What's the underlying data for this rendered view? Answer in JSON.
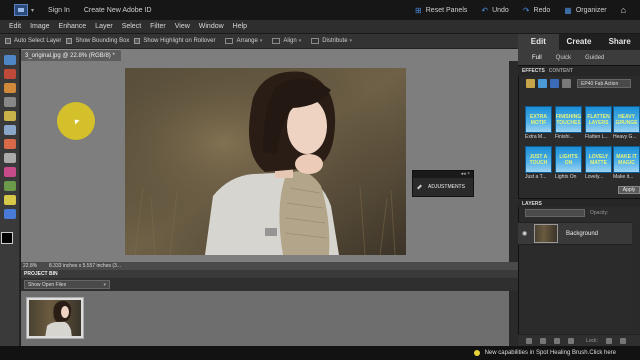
{
  "topbar": {
    "sign_in": "Sign In",
    "create_id": "Create New Adobe ID",
    "reset_panels": "Reset Panels",
    "undo": "Undo",
    "redo": "Redo",
    "organizer": "Organizer"
  },
  "menu": [
    "Edit",
    "Image",
    "Enhance",
    "Layer",
    "Select",
    "Filter",
    "View",
    "Window",
    "Help"
  ],
  "options": {
    "auto_select": "Auto Select Layer",
    "show_bounding": "Show Bounding Box",
    "show_highlight": "Show Highlight on Rollover",
    "arrange": "Arrange",
    "align": "Align",
    "distribute": "Distribute"
  },
  "document": {
    "tab_label": "3_original.jpg @ 22.8% (RGB/8) *",
    "zoom": "22.8%",
    "dimensions": "8.333 inches x 5.557 inches (3..."
  },
  "adjustments_panel": {
    "label": "ADJUSTMENTS"
  },
  "project_bin": {
    "title": "PROJECT BIN",
    "filter": "Show Open Files"
  },
  "right_panel": {
    "tabs": [
      "Edit",
      "Create",
      "Share"
    ],
    "subtabs": [
      "Full",
      "Quick",
      "Guided"
    ],
    "effects_header": "EFFECTS",
    "content_header": "CONTENT",
    "effects_select": "EP40 Fab Action",
    "effects": [
      {
        "swatch": "EXTRA MOTIF",
        "label": "Extra M..."
      },
      {
        "swatch": "FINISHING TOUCHES",
        "label": "Finishi..."
      },
      {
        "swatch": "FLATTEN LAYERS",
        "label": "Flatten L..."
      },
      {
        "swatch": "HEAVY GRUNGE",
        "label": "Heavy G..."
      },
      {
        "swatch": "JUST A TOUCH",
        "label": "Just a T..."
      },
      {
        "swatch": "LIGHTS ON",
        "label": "Lights On"
      },
      {
        "swatch": "LOVELY MATTE",
        "label": "Lovely..."
      },
      {
        "swatch": "MAKE IT MAGIC",
        "label": "Make it..."
      }
    ],
    "apply": "Apply",
    "layers_header": "LAYERS",
    "opacity_label": "Opacity:",
    "layer_name": "Background",
    "lock_label": "Lock:"
  },
  "status": {
    "message": "New capabilities in Spot Healing Brush.Click here"
  },
  "colors": {
    "cursor_highlight": "#d3c02a",
    "accent_blue": "#4a8ad8",
    "effect_swatch": "#1d8fd6"
  }
}
